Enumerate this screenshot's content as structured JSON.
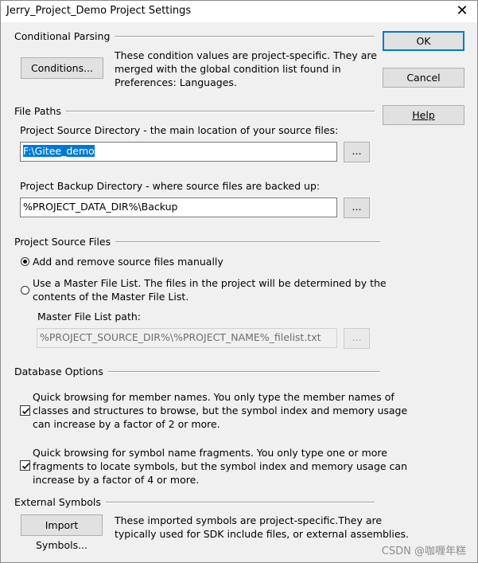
{
  "window": {
    "title": "Jerry_Project_Demo Project Settings",
    "close_glyph": "✕"
  },
  "buttons": {
    "ok": "OK",
    "cancel": "Cancel",
    "help": "Help"
  },
  "conditional_parsing": {
    "heading": "Conditional Parsing",
    "button": "Conditions...",
    "description_lines": [
      "These condition values are project-specific.  They are",
      "merged with the global condition list found in",
      "Preferences: Languages."
    ]
  },
  "file_paths": {
    "heading": "File Paths",
    "source_label": "Project Source Directory - the main location of your source files:",
    "source_value": "F:\\Gitee_demo",
    "backup_label": "Project Backup Directory - where source files are backed up:",
    "backup_value": "%PROJECT_DATA_DIR%\\Backup",
    "browse": "..."
  },
  "project_source_files": {
    "heading": "Project Source Files",
    "option_manual": "Add and remove source files manually",
    "option_master_lines": [
      "Use a Master File List. The files in the project will be determined by the",
      "contents of the Master File List."
    ],
    "master_label": "Master File List path:",
    "master_value": "%PROJECT_SOURCE_DIR%\\%PROJECT_NAME%_filelist.txt",
    "browse": "...",
    "selected": "manual"
  },
  "database_options": {
    "heading": "Database Options",
    "quick_member_lines": [
      "Quick browsing for member names.  You only type the member names of",
      "classes and structures to browse, but the symbol index and memory usage",
      "can increase by a factor of 2 or more."
    ],
    "quick_member_checked": true,
    "quick_symbol_lines": [
      "Quick browsing for symbol name fragments.  You only type one or more",
      "fragments to locate symbols, but the symbol index and memory usage can",
      "increase by a factor of 4 or more."
    ],
    "quick_symbol_checked": true
  },
  "external_symbols": {
    "heading": "External Symbols",
    "button": "Import Symbols...",
    "description_lines": [
      "These imported symbols are project-specific.They are",
      "typically used for SDK include files, or external assemblies."
    ]
  },
  "watermark": "CSDN @咖喱年糕",
  "colors": {
    "accent": "#0078d7",
    "selection": "#0078d7"
  }
}
